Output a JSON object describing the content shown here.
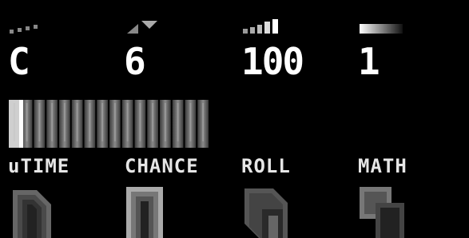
{
  "params": [
    {
      "icon": "dots-rising-icon",
      "value": "C"
    },
    {
      "icon": "triangle-arrow-icon",
      "value": "6"
    },
    {
      "icon": "signal-bars-icon",
      "value": "100"
    },
    {
      "icon": "gradient-bar-icon",
      "value": "1"
    }
  ],
  "modules": [
    {
      "label": "uTIME",
      "icon": "hexagon-icon"
    },
    {
      "label": "CHANCE",
      "icon": "arch-icon"
    },
    {
      "label": "ROLL",
      "icon": "cube-icon"
    },
    {
      "label": "MATH",
      "icon": "overlap-squares-icon"
    }
  ],
  "steps": {
    "count": 16,
    "active_index": 0
  },
  "colors": {
    "background": "#000000",
    "text": "#ffffff",
    "dim": "#777777"
  }
}
